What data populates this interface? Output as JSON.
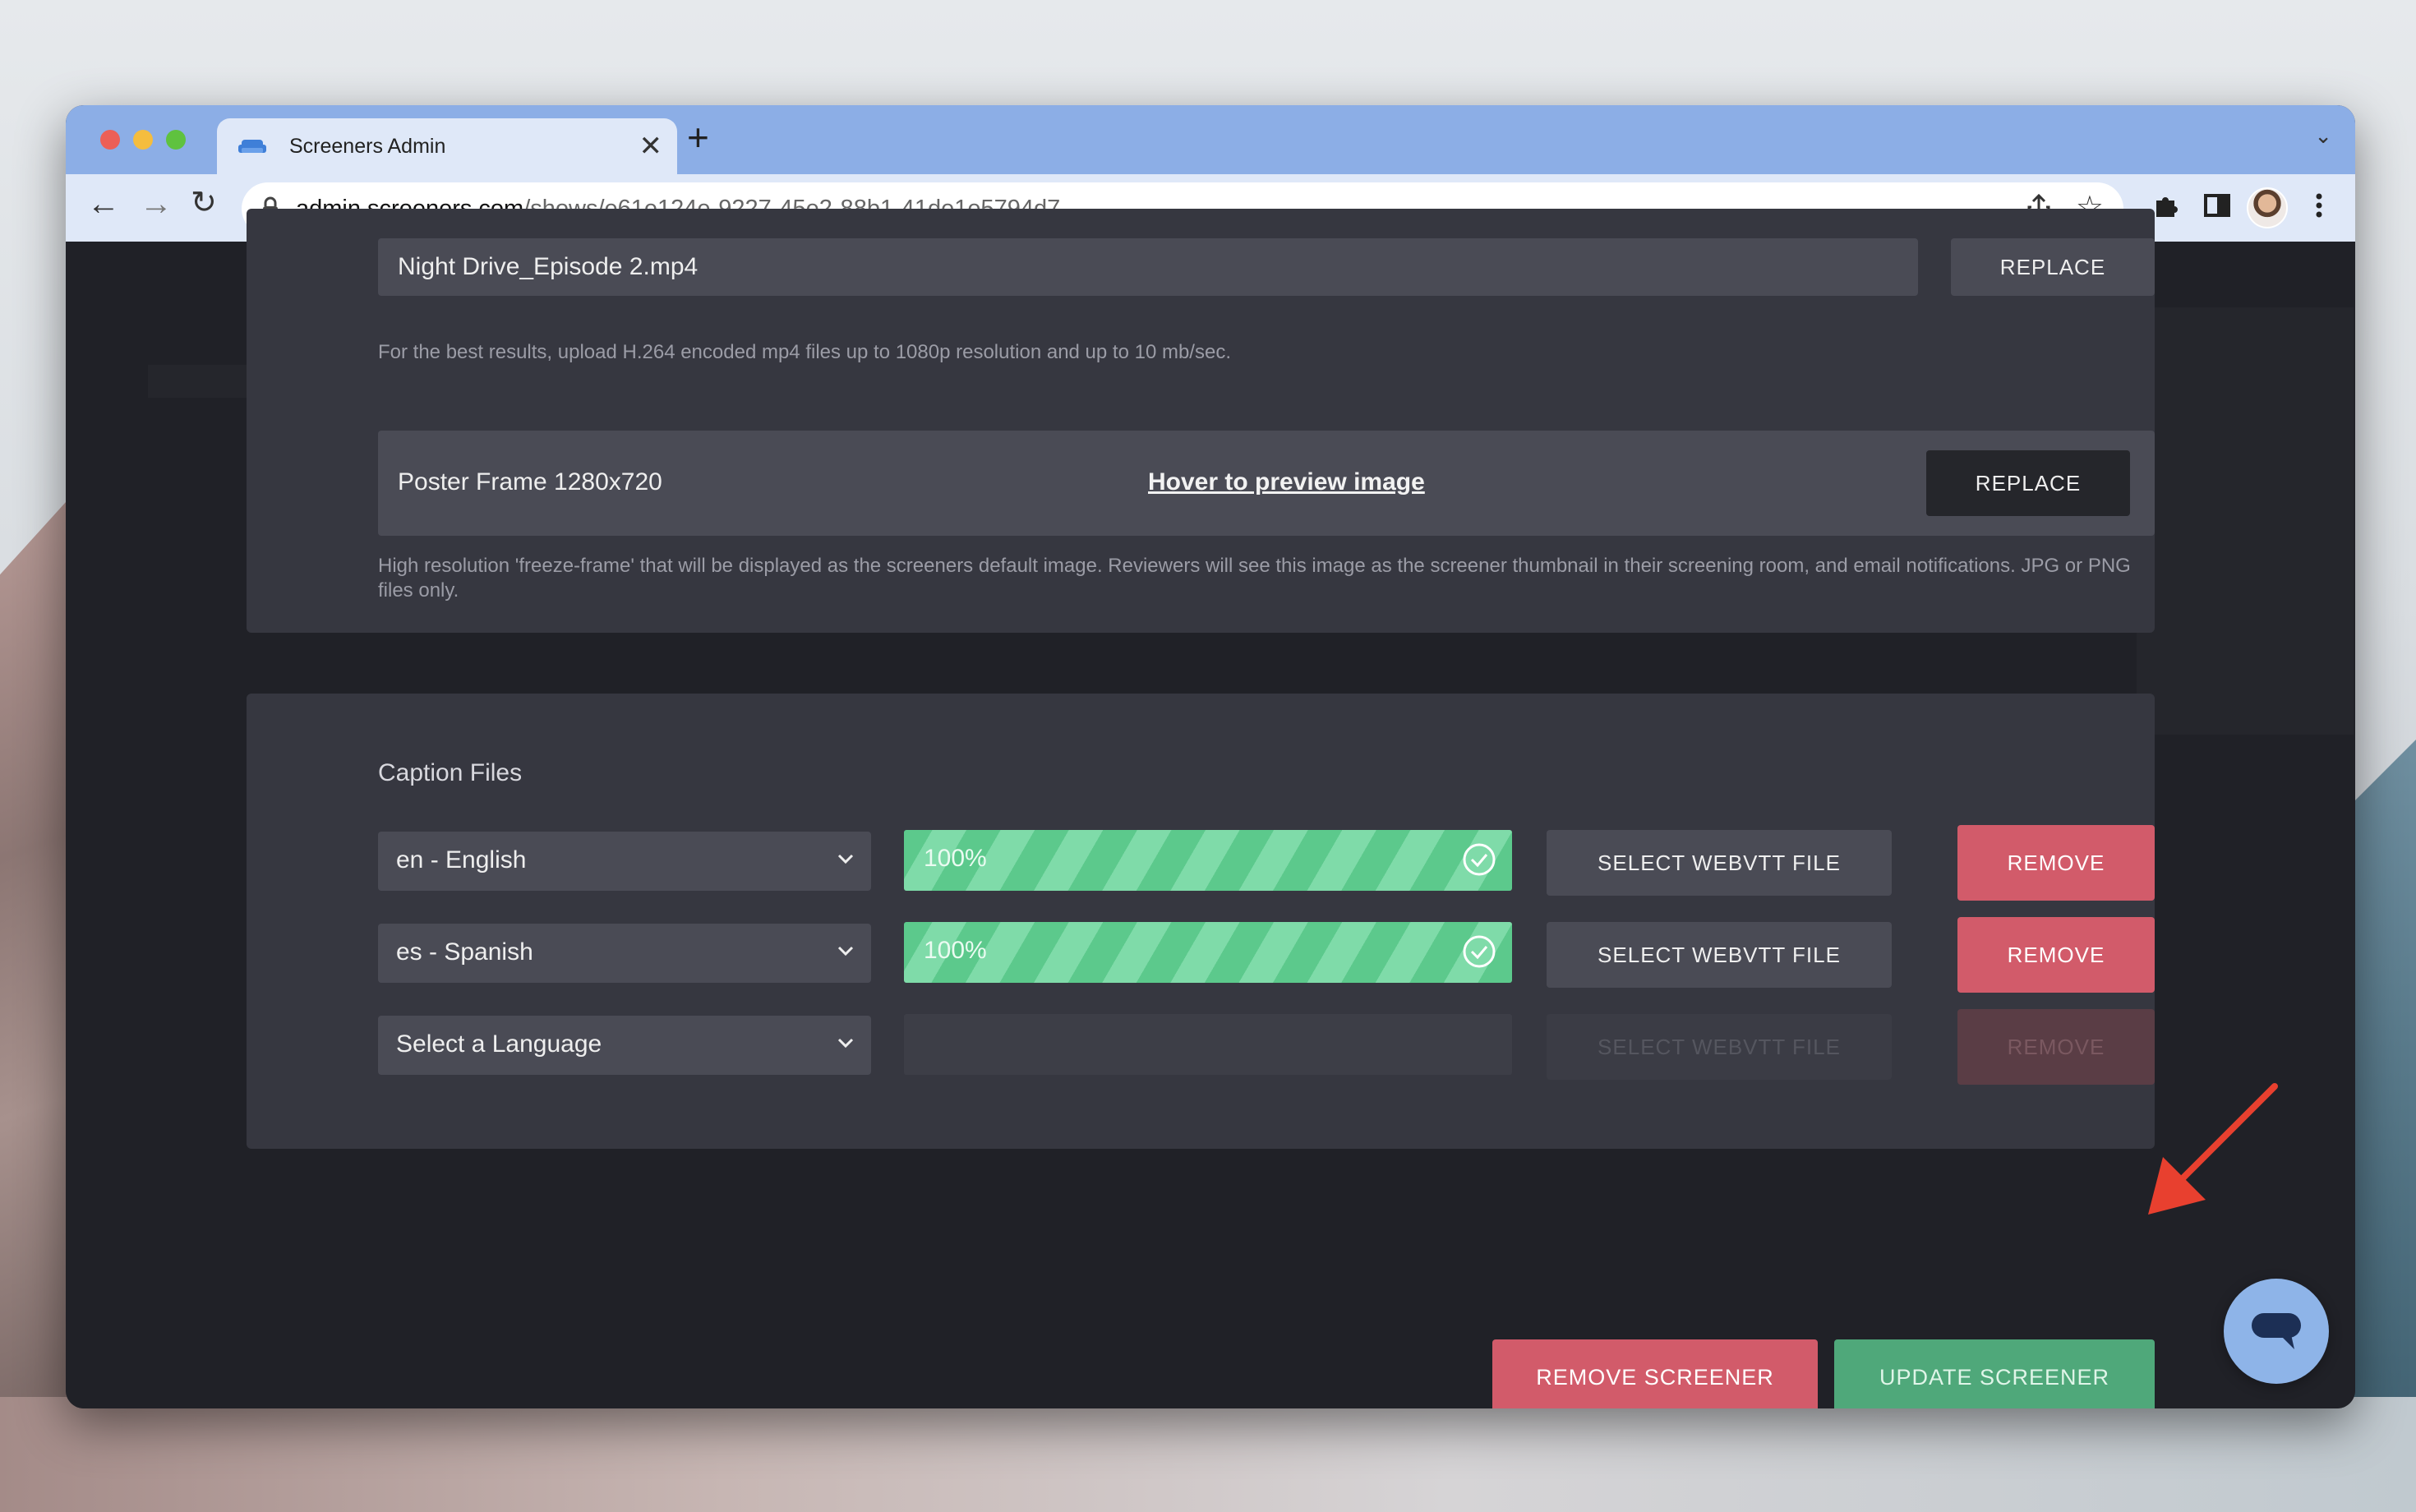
{
  "browser": {
    "tab_title": "Screeners Admin",
    "tab_close": "✕",
    "new_tab": "+",
    "url_host": "admin.screeners.com",
    "url_path": "/shows/e61e124e-9227-45e2-88b1-41de1e5794d7"
  },
  "video": {
    "file_name": "Night Drive_Episode 2.mp4",
    "replace_label": "REPLACE",
    "hint": "For the best results, upload H.264 encoded mp4 files up to 1080p resolution and up to 10 mb/sec."
  },
  "poster": {
    "label": "Poster Frame 1280x720",
    "preview_link": "Hover to preview image",
    "replace_label": "REPLACE",
    "hint": "High resolution 'freeze-frame' that will be displayed as the screeners default image. Reviewers will see this image as the screener thumbnail in their screening room, and email notifications. JPG or PNG files only."
  },
  "captions": {
    "title": "Caption Files",
    "rows": [
      {
        "language": "en - English",
        "progress": "100%",
        "progress_value": 1.0,
        "select_label": "SELECT WEBVTT FILE",
        "remove_label": "REMOVE"
      },
      {
        "language": "es - Spanish",
        "progress": "100%",
        "progress_value": 1.0,
        "select_label": "SELECT WEBVTT FILE",
        "remove_label": "REMOVE"
      },
      {
        "language": "Select a Language",
        "progress": "",
        "progress_value": 0,
        "select_label": "SELECT WEBVTT FILE",
        "remove_label": "REMOVE"
      }
    ]
  },
  "actions": {
    "remove_screener": "REMOVE SCREENER",
    "update_screener": "UPDATE SCREENER"
  },
  "colors": {
    "accent_red": "#d25b6a",
    "accent_green": "#4fa87a",
    "progress_green": "#5cc98c",
    "annotation_arrow": "#e8402f"
  }
}
